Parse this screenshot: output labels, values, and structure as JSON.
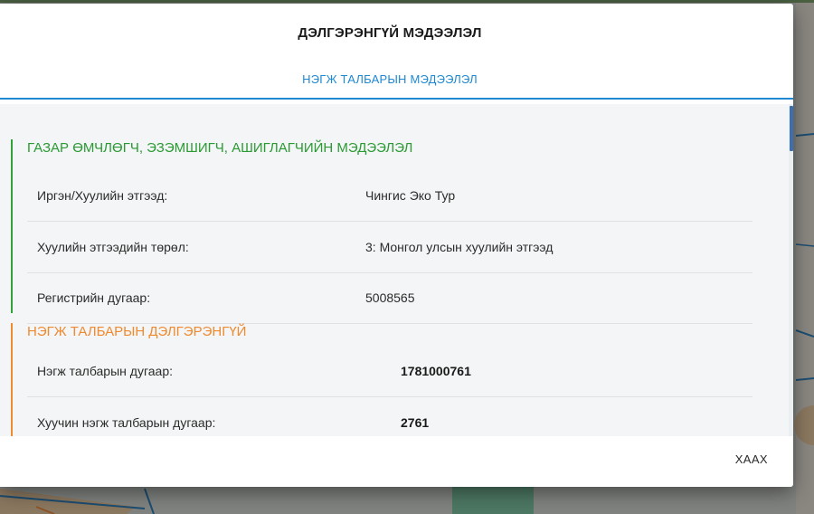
{
  "dialog": {
    "title": "ДЭЛГЭРЭНГҮЙ МЭДЭЭЛЭЛ",
    "tab_label": "НЭГЖ ТАЛБАРЫН МЭДЭЭЛЭЛ",
    "close_label": "ХААХ"
  },
  "owner_section": {
    "title": "ГАЗАР ӨМЧЛӨГЧ, ЭЗЭМШИГЧ, АШИГЛАГЧИЙН МЭДЭЭЛЭЛ",
    "rows": [
      {
        "label": "Иргэн/Хуулийн этгээд:",
        "value": "Чингис Эко Тур"
      },
      {
        "label": "Хуулийн этгээдийн төрөл:",
        "value": "3: Монгол улсын хуулийн этгээд"
      },
      {
        "label": "Регистрийн дугаар:",
        "value": "5008565"
      }
    ]
  },
  "parcel_section": {
    "title": "НЭГЖ ТАЛБАРЫН ДЭЛГЭРЭНГҮЙ",
    "rows": [
      {
        "label": "Нэгж талбарын дугаар:",
        "value": "1781000761"
      },
      {
        "label": "Хуучин нэгж талбарын дугаар:",
        "value": "2761"
      }
    ]
  },
  "colors": {
    "accent_blue": "#1e88d2",
    "section_green": "#2fa23a",
    "section_orange": "#f08b2f",
    "scroll_thumb": "#3b6fb0"
  }
}
